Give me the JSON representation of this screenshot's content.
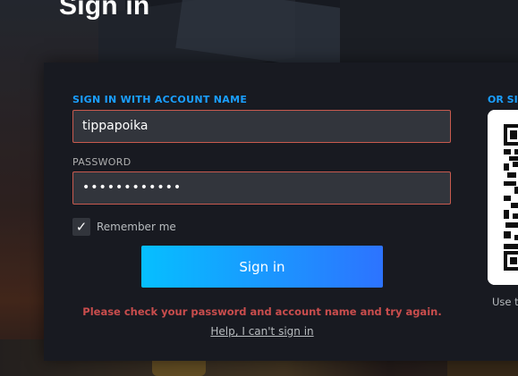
{
  "page": {
    "title": "Sign in"
  },
  "form": {
    "account_label": "SIGN IN WITH ACCOUNT NAME",
    "account_value": "tippapoika",
    "password_label": "PASSWORD",
    "password_value": "••••••••••••",
    "remember_label": "Remember me",
    "remember_checked": true,
    "checkmark": "✓",
    "signin_label": "Sign in",
    "error_text": "Please check your password and account name and try again.",
    "help_link": "Help, I can't sign in"
  },
  "qr": {
    "title": "OR SIG",
    "caption": "Use t"
  },
  "colors": {
    "accent": "#1a9fff",
    "error": "#c94d4d",
    "field_border": "#c85a4e",
    "button_start": "#06bfff",
    "button_end": "#2d73ff"
  }
}
